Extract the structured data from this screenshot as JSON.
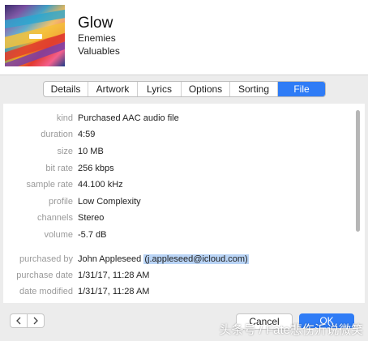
{
  "header": {
    "title": "Glow",
    "artist": "Enemies",
    "album": "Valuables"
  },
  "tabs": [
    {
      "label": "Details"
    },
    {
      "label": "Artwork"
    },
    {
      "label": "Lyrics"
    },
    {
      "label": "Options"
    },
    {
      "label": "Sorting"
    },
    {
      "label": "File",
      "active": true
    }
  ],
  "file_info": {
    "kind": {
      "label": "kind",
      "value": "Purchased AAC audio file"
    },
    "duration": {
      "label": "duration",
      "value": "4:59"
    },
    "size": {
      "label": "size",
      "value": "10 MB"
    },
    "bit_rate": {
      "label": "bit rate",
      "value": "256 kbps"
    },
    "sample_rate": {
      "label": "sample rate",
      "value": "44.100 kHz"
    },
    "profile": {
      "label": "profile",
      "value": "Low Complexity"
    },
    "channels": {
      "label": "channels",
      "value": "Stereo"
    },
    "volume": {
      "label": "volume",
      "value": "-5.7 dB"
    },
    "purchased_by": {
      "label": "purchased by",
      "value": "John Appleseed",
      "email": "(j.appleseed@icloud.com)"
    },
    "purchase_date": {
      "label": "purchase date",
      "value": "1/31/17, 11:28 AM"
    },
    "date_modified": {
      "label": "date modified",
      "value": "1/31/17, 11:28 AM"
    }
  },
  "buttons": {
    "cancel": "Cancel",
    "ok": "OK"
  },
  "watermark": "头条号 / Fate悲伤沂说微笑",
  "colors": {
    "accent": "#2f7cf6",
    "selection": "#b9d4f6"
  }
}
